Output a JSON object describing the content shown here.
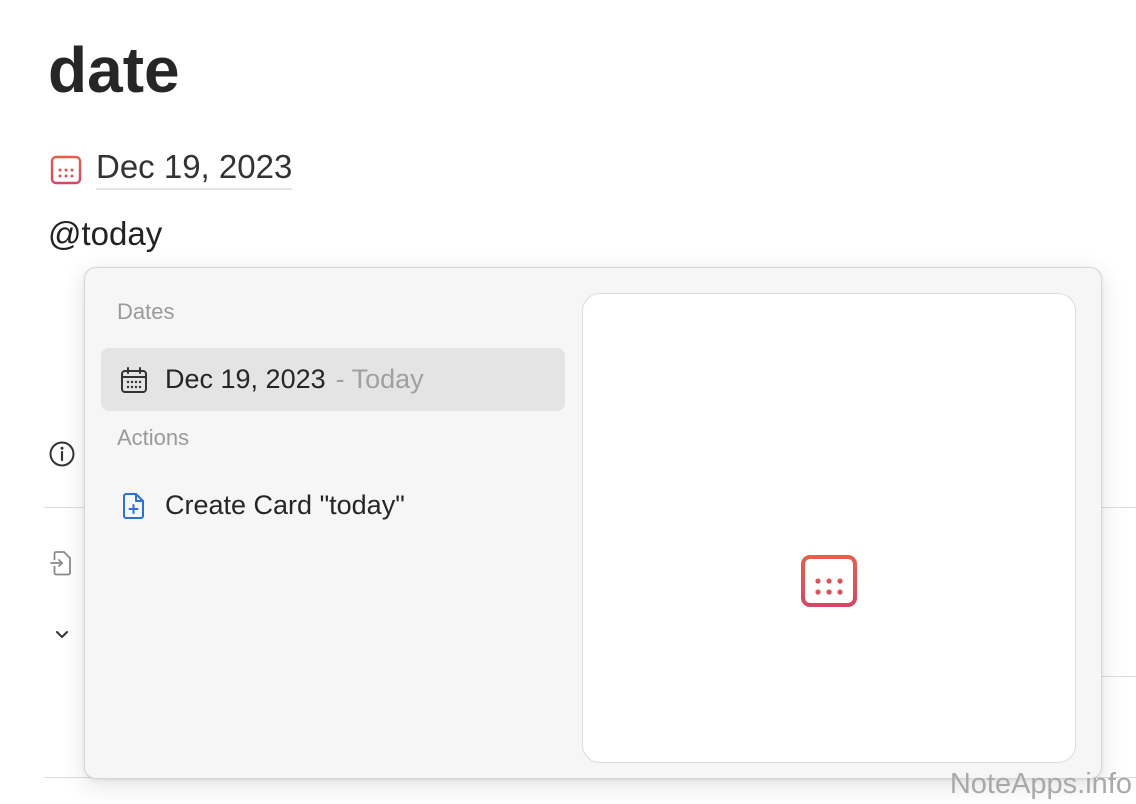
{
  "page": {
    "title": "date",
    "date_value": "Dec 19, 2023",
    "mention_text": "@today"
  },
  "popup": {
    "sections": {
      "dates_header": "Dates",
      "actions_header": "Actions"
    },
    "date_item": {
      "label": "Dec 19, 2023",
      "suffix": "- Today",
      "icon": "calendar-icon"
    },
    "action_item": {
      "label": "Create Card \"today\"",
      "icon": "new-document-icon"
    },
    "preview": {
      "icon": "calendar-icon"
    }
  },
  "background_icons": [
    "info-icon",
    "document-import-icon",
    "chevron-down-icon"
  ],
  "colors": {
    "calendar_gradient_top": "#e5604a",
    "calendar_gradient_bottom": "#d44866",
    "action_icon_blue": "#2f6fd6",
    "selected_bg": "#e4e4e5"
  },
  "watermark": "NoteApps.info"
}
